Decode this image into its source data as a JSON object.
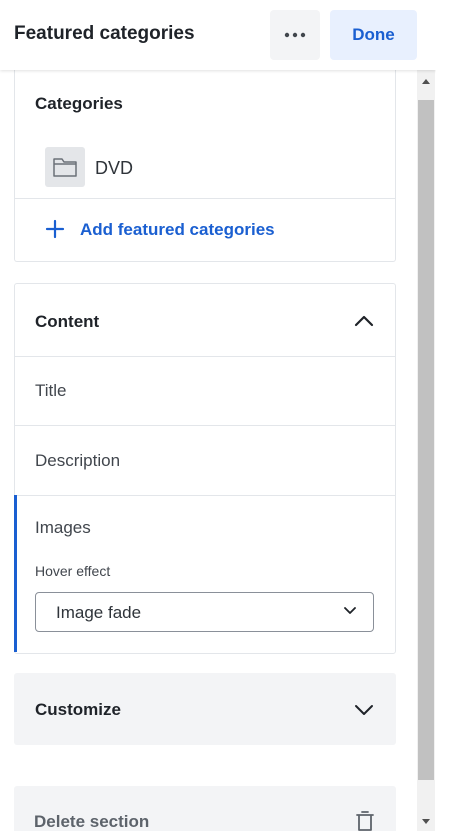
{
  "header": {
    "title": "Featured categories",
    "more_icon": "more-horizontal-icon",
    "done_label": "Done"
  },
  "categories_card": {
    "heading": "Categories",
    "items": [
      {
        "label": "DVD",
        "icon": "folder-icon"
      }
    ],
    "add_label": "Add featured categories",
    "add_icon": "plus-icon"
  },
  "content_card": {
    "heading": "Content",
    "expanded": true,
    "fields": [
      {
        "label": "Title"
      },
      {
        "label": "Description"
      },
      {
        "label": "Images"
      }
    ],
    "active_field": "Images",
    "hover_effect": {
      "label": "Hover effect",
      "selected": "Image fade"
    }
  },
  "customize": {
    "label": "Customize",
    "expanded": false
  },
  "delete_section": {
    "label": "Delete section",
    "icon": "trash-icon"
  },
  "colors": {
    "accent": "#1a5fd1",
    "done_bg": "#e8f0fe",
    "muted_bg": "#f3f4f6"
  }
}
